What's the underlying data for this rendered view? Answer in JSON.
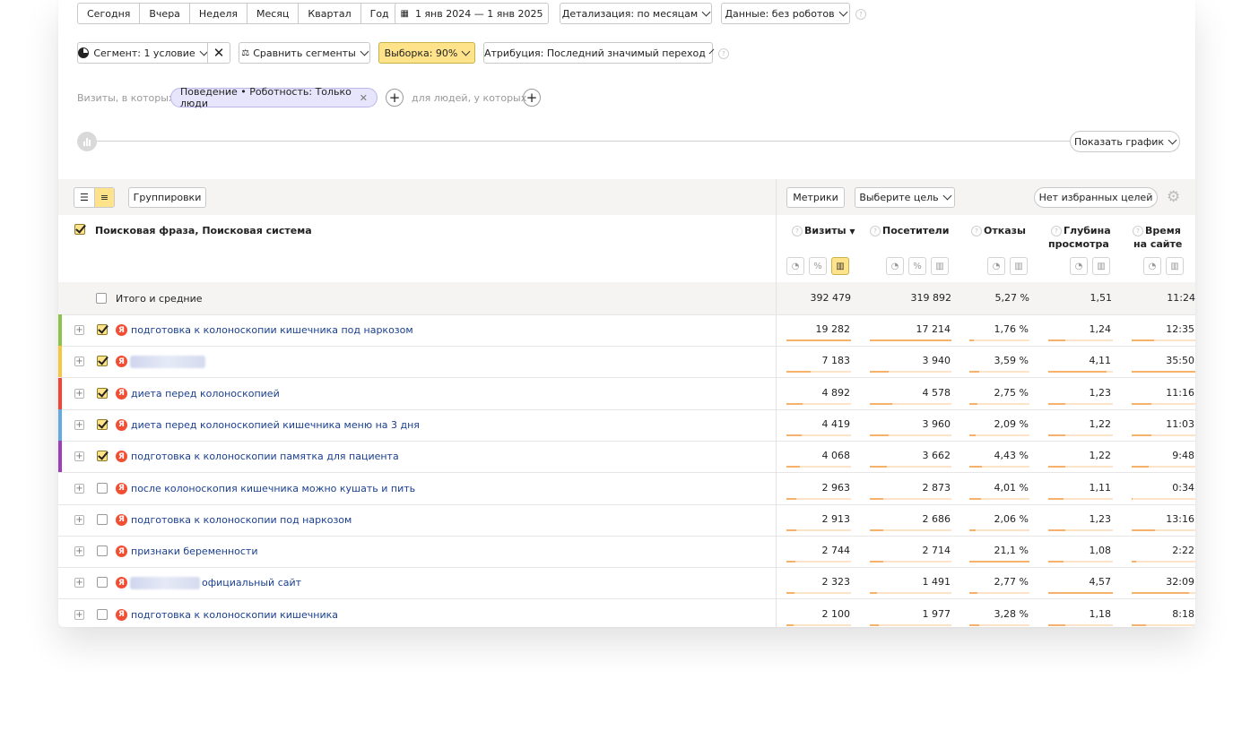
{
  "period_tabs": [
    "Сегодня",
    "Вчера",
    "Неделя",
    "Месяц",
    "Квартал",
    "Год"
  ],
  "date_range": "1 янв 2024 — 1 янв 2025",
  "detail": "Детализация: по месяцам",
  "data_filter": "Данные: без роботов",
  "segment": "Сегмент: 1 условие",
  "compare": "Сравнить сегменты",
  "sample": "Выборка: 90%",
  "attribution": "Атрибуция: Последний значимый переход",
  "filter_bar": {
    "visits_label": "Визиты, в которых",
    "chip": "Поведение • Роботность: Только люди",
    "people_label": "для людей, у которых"
  },
  "show_chart": "Показать график",
  "toolbar": {
    "groupings": "Группировки",
    "metrics": "Метрики",
    "goal": "Выберите цель",
    "favorites": "Нет избранных целей"
  },
  "table": {
    "dimension_header": "Поисковая фраза, Поисковая система",
    "columns": [
      {
        "label": "Визиты",
        "label2": "",
        "sort": "▼"
      },
      {
        "label": "Посетители",
        "label2": ""
      },
      {
        "label": "Отказы",
        "label2": ""
      },
      {
        "label": "Глубина",
        "label2": "просмотра"
      },
      {
        "label": "Время",
        "label2": "на сайте"
      }
    ],
    "totals": {
      "label": "Итого и средние",
      "values": [
        "392 479",
        "319 892",
        "5,27 %",
        "1,51",
        "11:24"
      ]
    },
    "rows": [
      {
        "stripe": "#8bc34a",
        "checked": true,
        "phrase": "подготовка к колоноскопии кишечника под наркозом",
        "values": [
          "19 282",
          "17 214",
          "1,76 %",
          "1,24",
          "12:35"
        ],
        "fill": [
          1.0,
          1.0,
          0.08,
          0.27,
          0.35
        ]
      },
      {
        "stripe": "#f5c642",
        "checked": true,
        "phrase": "",
        "blurred": true,
        "values": [
          "7 183",
          "3 940",
          "3,59 %",
          "4,11",
          "35:50"
        ],
        "fill": [
          0.37,
          0.23,
          0.17,
          0.9,
          1.0
        ]
      },
      {
        "stripe": "#f44336",
        "checked": true,
        "phrase": "диета перед колоноскопией",
        "values": [
          "4 892",
          "4 578",
          "2,75 %",
          "1,23",
          "11:16"
        ],
        "fill": [
          0.25,
          0.27,
          0.13,
          0.27,
          0.31
        ]
      },
      {
        "stripe": "#64a9e4",
        "checked": true,
        "phrase": "диета перед колоноскопией кишечника меню на 3 дня",
        "values": [
          "4 419",
          "3 960",
          "2,09 %",
          "1,22",
          "11:03"
        ],
        "fill": [
          0.23,
          0.23,
          0.1,
          0.27,
          0.31
        ]
      },
      {
        "stripe": "#9c3fb8",
        "checked": true,
        "phrase": "подготовка к колоноскопии памятка для пациента",
        "values": [
          "4 068",
          "3 662",
          "4,43 %",
          "1,22",
          "9:48"
        ],
        "fill": [
          0.21,
          0.21,
          0.21,
          0.27,
          0.27
        ]
      },
      {
        "stripe": "",
        "checked": false,
        "phrase": "после колоноскопия кишечника можно кушать и пить",
        "values": [
          "2 963",
          "2 873",
          "4,01 %",
          "1,11",
          "0:34"
        ],
        "fill": [
          0.15,
          0.17,
          0.19,
          0.24,
          0.02
        ]
      },
      {
        "stripe": "",
        "checked": false,
        "phrase": "подготовка к колоноскопии под наркозом",
        "values": [
          "2 913",
          "2 686",
          "2,06 %",
          "1,23",
          "13:16"
        ],
        "fill": [
          0.15,
          0.16,
          0.1,
          0.27,
          0.37
        ]
      },
      {
        "stripe": "",
        "checked": false,
        "phrase": "признаки беременности",
        "values": [
          "2 744",
          "2 714",
          "21,1 %",
          "1,08",
          "2:22"
        ],
        "fill": [
          0.14,
          0.16,
          1.0,
          0.24,
          0.07
        ]
      },
      {
        "stripe": "",
        "checked": false,
        "phrase": "официальный сайт",
        "blurred_prefix": true,
        "values": [
          "2 323",
          "1 491",
          "2,77 %",
          "4,57",
          "32:09"
        ],
        "fill": [
          0.12,
          0.09,
          0.13,
          1.0,
          0.9
        ]
      },
      {
        "stripe": "",
        "checked": false,
        "phrase": "подготовка к колоноскопии кишечника",
        "values": [
          "2 100",
          "1 977",
          "3,28 %",
          "1,18",
          "8:18"
        ],
        "fill": [
          0.11,
          0.11,
          0.16,
          0.26,
          0.23
        ]
      }
    ]
  }
}
